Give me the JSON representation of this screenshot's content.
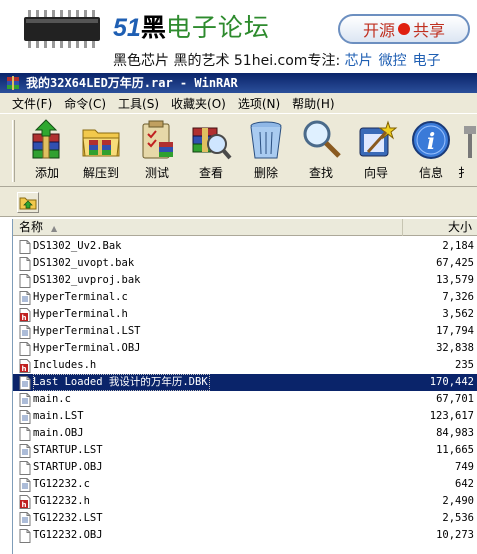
{
  "banner": {
    "logo_number": "51",
    "logo_black": "黑",
    "logo_text": "电子论坛",
    "badge_left": "开源",
    "badge_right": "共享",
    "tagline": "黑色芯片 黑的艺术  51hei.com专注:",
    "tagline_links": [
      "芯片",
      "微控",
      "电子"
    ]
  },
  "window": {
    "title": "我的32X64LED万年历.rar - WinRAR"
  },
  "menu": [
    "文件(F)",
    "命令(C)",
    "工具(S)",
    "收藏夹(O)",
    "选项(N)",
    "帮助(H)"
  ],
  "toolbar": {
    "buttons": [
      {
        "label": "添加",
        "icon": "add-archive-icon"
      },
      {
        "label": "解压到",
        "icon": "extract-to-icon"
      },
      {
        "label": "测试",
        "icon": "test-archive-icon"
      },
      {
        "label": "查看",
        "icon": "view-file-icon"
      },
      {
        "label": "删除",
        "icon": "delete-icon"
      },
      {
        "label": "查找",
        "icon": "find-icon"
      },
      {
        "label": "向导",
        "icon": "wizard-icon"
      },
      {
        "label": "信息",
        "icon": "info-icon"
      },
      {
        "label": "扌",
        "icon": "repair-icon"
      }
    ]
  },
  "list": {
    "header_name": "名称",
    "header_size": "大小",
    "files": [
      {
        "name": "DS1302_Uv2.Bak",
        "size": "2,184",
        "type": "blank"
      },
      {
        "name": "DS1302_uvopt.bak",
        "size": "67,425",
        "type": "blank"
      },
      {
        "name": "DS1302_uvproj.bak",
        "size": "13,579",
        "type": "blank"
      },
      {
        "name": "HyperTerminal.c",
        "size": "7,326",
        "type": "text"
      },
      {
        "name": "HyperTerminal.h",
        "size": "3,562",
        "type": "header"
      },
      {
        "name": "HyperTerminal.LST",
        "size": "17,794",
        "type": "text"
      },
      {
        "name": "HyperTerminal.OBJ",
        "size": "32,838",
        "type": "blank"
      },
      {
        "name": "Includes.h",
        "size": "235",
        "type": "header"
      },
      {
        "name": "Last Loaded 我设计的万年历.DBK",
        "size": "170,442",
        "type": "text"
      },
      {
        "name": "main.c",
        "size": "67,701",
        "type": "text"
      },
      {
        "name": "main.LST",
        "size": "123,617",
        "type": "text"
      },
      {
        "name": "main.OBJ",
        "size": "84,983",
        "type": "blank"
      },
      {
        "name": "STARTUP.LST",
        "size": "11,665",
        "type": "text"
      },
      {
        "name": "STARTUP.OBJ",
        "size": "749",
        "type": "blank"
      },
      {
        "name": "TG12232.c",
        "size": "642",
        "type": "text"
      },
      {
        "name": "TG12232.h",
        "size": "2,490",
        "type": "header"
      },
      {
        "name": "TG12232.LST",
        "size": "2,536",
        "type": "text"
      },
      {
        "name": "TG12232.OBJ",
        "size": "10,273",
        "type": "blank"
      }
    ],
    "selected_index": 8
  },
  "colors": {
    "selection": "#0a246a",
    "chrome": "#ece9d8",
    "brand_blue": "#1f5fb3",
    "brand_green": "#2e8b2e"
  }
}
